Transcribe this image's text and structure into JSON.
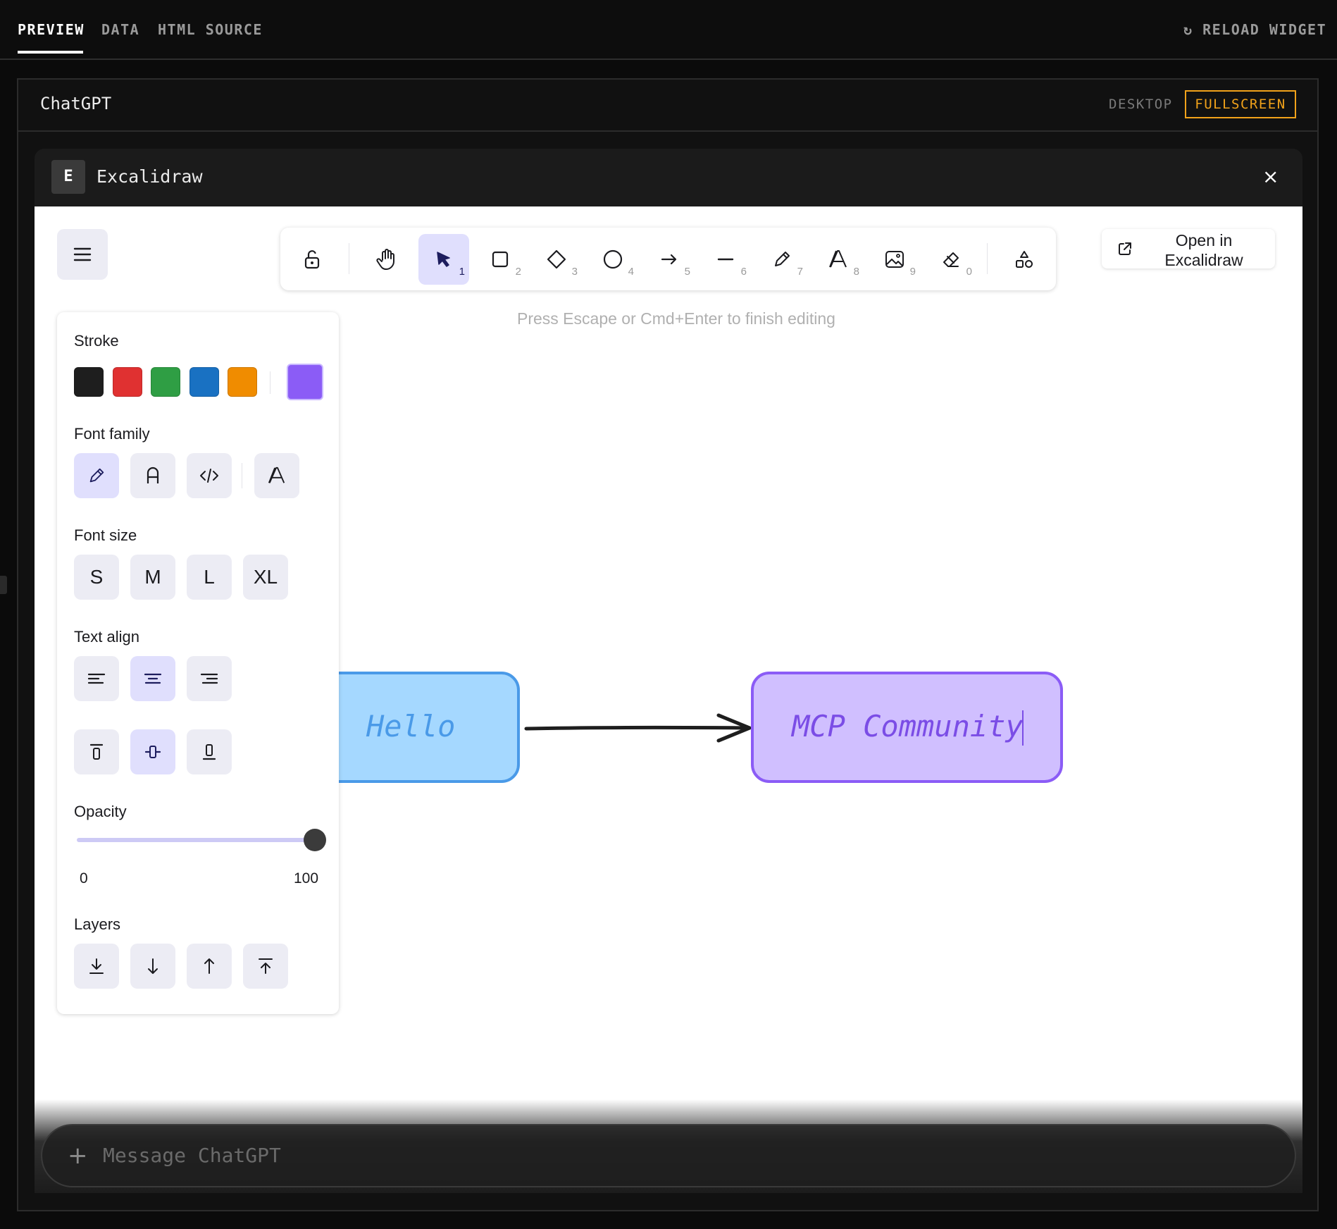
{
  "tabs": [
    {
      "label": "PREVIEW",
      "active": true
    },
    {
      "label": "DATA",
      "active": false
    },
    {
      "label": "HTML SOURCE",
      "active": false
    }
  ],
  "reload_label": "↻ RELOAD WIDGET",
  "frame": {
    "title": "ChatGPT",
    "modes": {
      "desktop": "DESKTOP",
      "fullscreen": "FULLSCREEN",
      "active": "FULLSCREEN"
    }
  },
  "widget": {
    "badge": "E",
    "title": "Excalidraw",
    "close": "×"
  },
  "toolbar": {
    "tools": [
      {
        "name": "lock-icon",
        "key": ""
      },
      {
        "name": "hand-icon",
        "key": ""
      },
      {
        "name": "selection-icon",
        "key": "1",
        "selected": true
      },
      {
        "name": "rectangle-icon",
        "key": "2"
      },
      {
        "name": "diamond-icon",
        "key": "3"
      },
      {
        "name": "ellipse-icon",
        "key": "4"
      },
      {
        "name": "arrow-icon",
        "key": "5"
      },
      {
        "name": "line-icon",
        "key": "6"
      },
      {
        "name": "pencil-icon",
        "key": "7"
      },
      {
        "name": "text-icon",
        "key": "8"
      },
      {
        "name": "image-icon",
        "key": "9"
      },
      {
        "name": "eraser-icon",
        "key": "0"
      },
      {
        "name": "shapes-library-icon",
        "key": ""
      }
    ]
  },
  "open_in_excalidraw": "Open in Excalidraw",
  "hint": "Press Escape or Cmd+Enter to finish editing",
  "properties": {
    "stroke_label": "Stroke",
    "stroke_colors": [
      "#1e1e1e",
      "#e03131",
      "#2f9e44",
      "#1971c2",
      "#f08c00"
    ],
    "stroke_current": "#8b5cf6",
    "font_family_label": "Font family",
    "font_size_label": "Font size",
    "font_sizes": [
      "S",
      "M",
      "L",
      "XL"
    ],
    "text_align_label": "Text align",
    "opacity_label": "Opacity",
    "opacity_value": 100,
    "opacity_min": "0",
    "opacity_max": "100",
    "layers_label": "Layers"
  },
  "canvas": {
    "hello_text": "Hello",
    "mcp_text": "MCP Community",
    "hello_fill": "#a5d8ff",
    "mcp_fill": "#d0bfff"
  },
  "composer": {
    "plus": "+",
    "placeholder": "Message ChatGPT"
  }
}
